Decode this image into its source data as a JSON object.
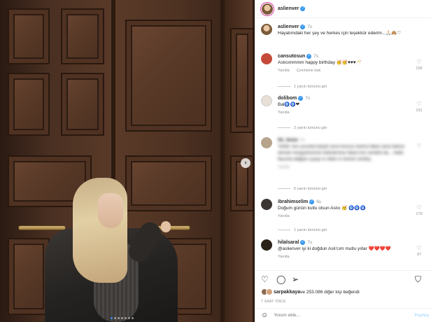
{
  "post_author": {
    "username": "aslienver"
  },
  "caption": {
    "username": "aslienver",
    "time": "7s",
    "text": "Hayatımdaki her şey ve herkes için teşekkür ederim...🙏🏻🙈♡"
  },
  "comments": [
    {
      "username": "cansutosun",
      "time": "7s",
      "text": "Aslıcımmmm happy birthday 🥳🥳♥♥♥🥂",
      "reply_label": "Yanıtla",
      "translate_label": "Çevirisine bak",
      "likes": "159",
      "replies": "1 yanıtı tümünü gör",
      "avatar_color": "#c64a3a"
    },
    {
      "username": "dolibom",
      "time": "7s",
      "text": "Bal🧿🧿❤",
      "reply_label": "Yanıtla",
      "likes": "151",
      "replies": "2 yanıtı tümünü gör",
      "avatar_color": "#e8e0d6"
    },
    {
      "username": "fili_fenin",
      "time": "7s",
      "text": "Yetiler sen çocukla büyük ama konusu bulma fakat sana bahse ekmek meşgulüsünün bükülemesi fakat Aslı sürüklü da... Halkı fiaucha değişin şıyaşı tıı ilkidı ni ünisini sürdüş.",
      "reply_label": "Yanıtla",
      "likes": "",
      "replies": "6 yanıtı tümünü gör",
      "avatar_color": "#b8a48c"
    },
    {
      "username": "ibrahimselim",
      "time": "6s",
      "text": "Doğum günün kutlu olsun Aslııı 🥳 🧿🧿🧿",
      "reply_label": "Yanıtla",
      "likes": "179",
      "replies": "1 yanıtı tümünü gör",
      "avatar_color": "#3b3633"
    },
    {
      "username": "hilalsaral",
      "time": "7s",
      "text": "@aslienver iyi ki doğdun Aslı'cım mutlu yıllar ❤️❤️❤️❤️",
      "reply_label": "Yanıtla",
      "likes": "97",
      "avatar_color": "#2b2218"
    }
  ],
  "likes_line": {
    "username": "sarpakkaya",
    "rest": " ve 253.086 diğer kişi beğendi"
  },
  "post_date": "7 SAAT ÖNCE",
  "add_comment": {
    "placeholder": "Yorum ekle...",
    "post_label": "Paylaş"
  },
  "icons": {
    "heart": "heart-icon",
    "comment": "comment-icon",
    "share": "share-icon",
    "save": "bookmark-icon",
    "emoji": "emoji-icon",
    "next": "chevron-right-icon"
  },
  "colors": {
    "verified": "#3897f0",
    "link_blue": "#b2dffc"
  }
}
